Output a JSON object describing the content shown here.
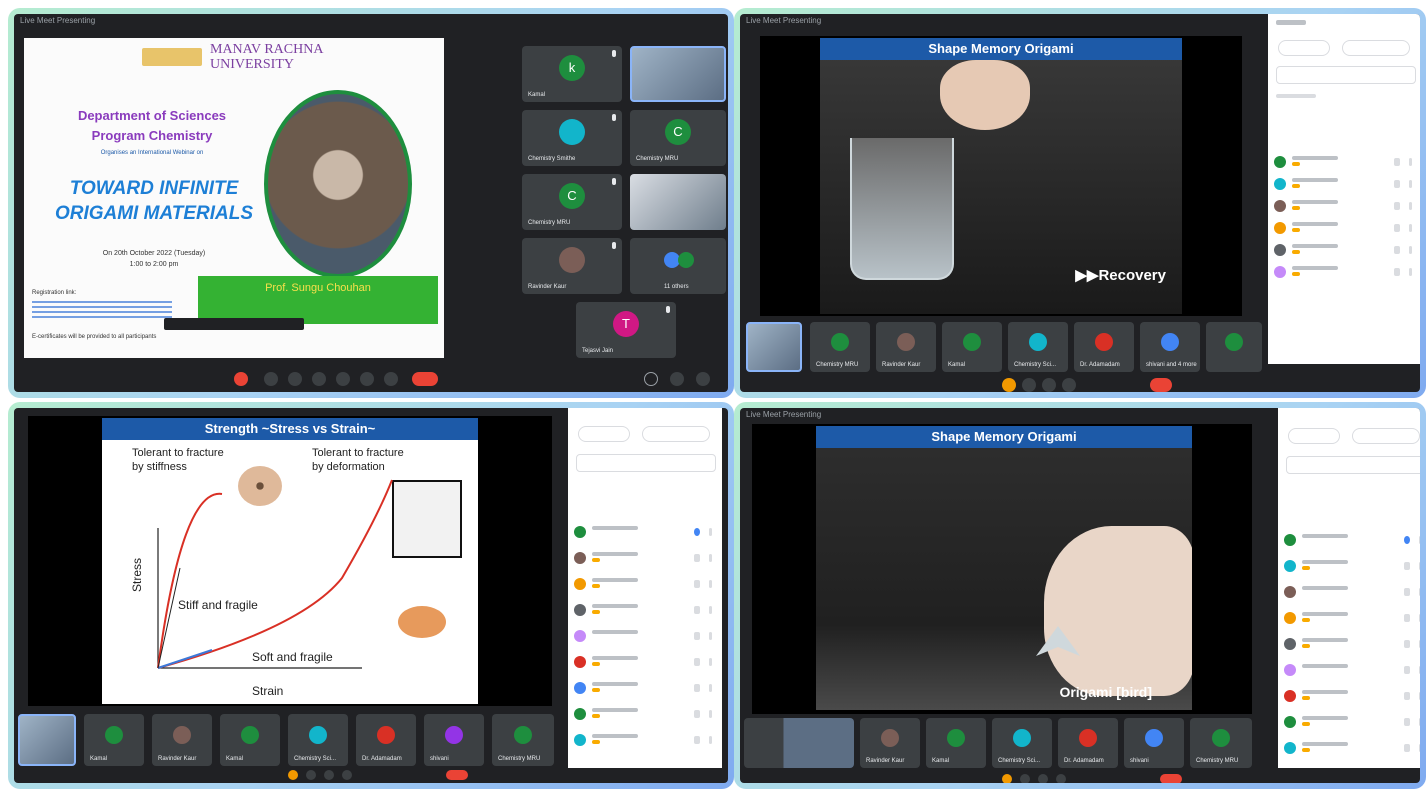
{
  "panel1": {
    "university": "MANAV RACHNA\nUNIVERSITY",
    "department": "Department of Sciences",
    "program": "Program Chemistry",
    "organises": "Organises an International Webinar on",
    "title_line1": "TOWARD INFINITE",
    "title_line2": "ORIGAMI MATERIALS",
    "date": "On 20th October 2022 (Tuesday)",
    "time": "1:00 to 2:00 pm",
    "speaker": "Prof. Sungu Chouhan",
    "registration_link": "Registration link:",
    "certificate_note": "E-certificates will be provided to all participants",
    "tiles": [
      {
        "initial": "k",
        "name": "Kamal",
        "color": "#1e8e3e"
      },
      {
        "initial": "",
        "name": "",
        "color": "#3c4043"
      },
      {
        "initial": "",
        "name": "Chemistry Smithe",
        "color": "#3c4043"
      },
      {
        "initial": "C",
        "name": "Chemistry MRU",
        "color": "#1e8e3e"
      },
      {
        "initial": "C",
        "name": "Chemistry MRU",
        "color": "#1e8e3e"
      },
      {
        "initial": "",
        "name": "",
        "color": "#3c4043"
      },
      {
        "initial": "",
        "name": "Ravinder Kaur",
        "color": "#3c4043"
      },
      {
        "initial": "",
        "name": "11 others",
        "color": "#3c4043"
      },
      {
        "initial": "T",
        "name": "Tejasvi Jain",
        "color": "#d01884"
      }
    ]
  },
  "panel2": {
    "slide_title": "Shape Memory Origami",
    "overlay": "▶▶Recovery",
    "tiles": [
      "Chemistry MRU",
      "Ravinder Kaur",
      "Kamal",
      "Chemistry Sci...",
      "Dr. Adamadam",
      "shivani and 4 more"
    ]
  },
  "panel3": {
    "slide_title": "Strength ~Stress vs Strain~",
    "label_tl": "Tolerant to fracture\nby stiffness",
    "label_tr": "Tolerant to fracture\nby deformation",
    "label_stiff": "Stiff and fragile",
    "label_soft": "Soft and fragile",
    "ylabel": "Stress",
    "xlabel": "Strain",
    "tiles": [
      "Kamal",
      "Ravinder Kaur",
      "Kamal",
      "Chemistry Sci...",
      "Dr. Adamadam",
      "shivani",
      "Chemistry MRU"
    ]
  },
  "panel4": {
    "slide_title": "Shape Memory Origami",
    "overlay": "Origami [bird]",
    "tiles": [
      "Chemistry MRU",
      "Ravinder Kaur",
      "Kamal",
      "Chemistry Sci...",
      "Dr. Adamadam",
      "shivani",
      "Chemistry MRU"
    ]
  },
  "participants_colors": [
    "#1e8e3e",
    "#7b5e57",
    "#c58af9",
    "#4285f4",
    "#d93025",
    "#f29900",
    "#12b5cb",
    "#9334e6"
  ]
}
